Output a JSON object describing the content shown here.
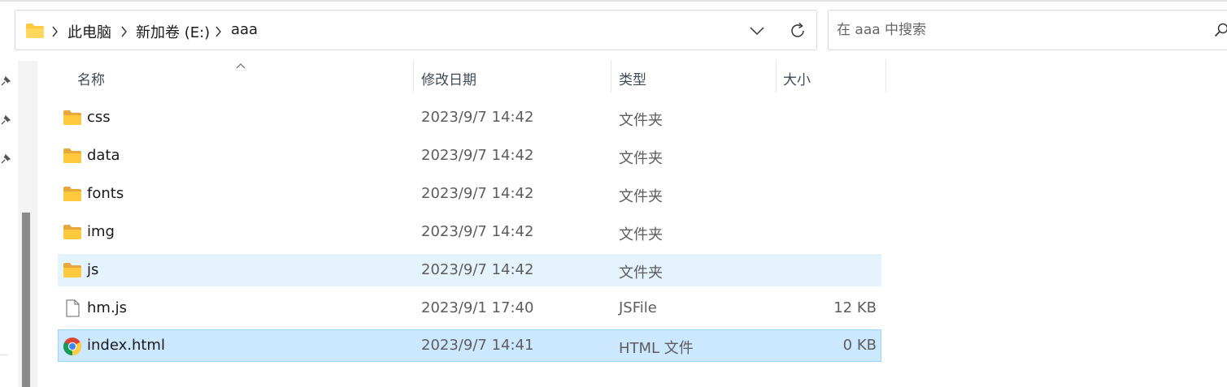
{
  "address": {
    "breadcrumbs": [
      "此电脑",
      "新加卷 (E:)",
      "aaa"
    ],
    "icons": {
      "folder": "folder-icon",
      "separator": "chevron-right-icon",
      "dropdown": "chevron-down-icon",
      "refresh": "refresh-icon"
    }
  },
  "search": {
    "placeholder": "在 aaa 中搜索",
    "value": "",
    "icon": "search-icon"
  },
  "columns": {
    "name": "名称",
    "modified": "修改日期",
    "type": "类型",
    "size": "大小",
    "sorted_by": "名称",
    "sort_direction": "ascending"
  },
  "files": [
    {
      "name": "css",
      "modified": "2023/9/7 14:42",
      "type": "文件夹",
      "size": "",
      "icon": "folder-icon",
      "state": "normal"
    },
    {
      "name": "data",
      "modified": "2023/9/7 14:42",
      "type": "文件夹",
      "size": "",
      "icon": "folder-icon",
      "state": "normal"
    },
    {
      "name": "fonts",
      "modified": "2023/9/7 14:42",
      "type": "文件夹",
      "size": "",
      "icon": "folder-icon",
      "state": "normal"
    },
    {
      "name": "img",
      "modified": "2023/9/7 14:42",
      "type": "文件夹",
      "size": "",
      "icon": "folder-icon",
      "state": "normal"
    },
    {
      "name": "js",
      "modified": "2023/9/7 14:42",
      "type": "文件夹",
      "size": "",
      "icon": "folder-icon",
      "state": "hover"
    },
    {
      "name": "hm.js",
      "modified": "2023/9/1 17:40",
      "type": "JSFile",
      "size": "12 KB",
      "icon": "file-icon",
      "state": "normal"
    },
    {
      "name": "index.html",
      "modified": "2023/9/7 14:41",
      "type": "HTML 文件",
      "size": "0 KB",
      "icon": "chrome-icon",
      "state": "selected"
    }
  ],
  "colors": {
    "hover": "#e5f3fd",
    "selected": "#cce8ff",
    "selected_border": "#99d1ff",
    "folder": "#ffc83d"
  }
}
